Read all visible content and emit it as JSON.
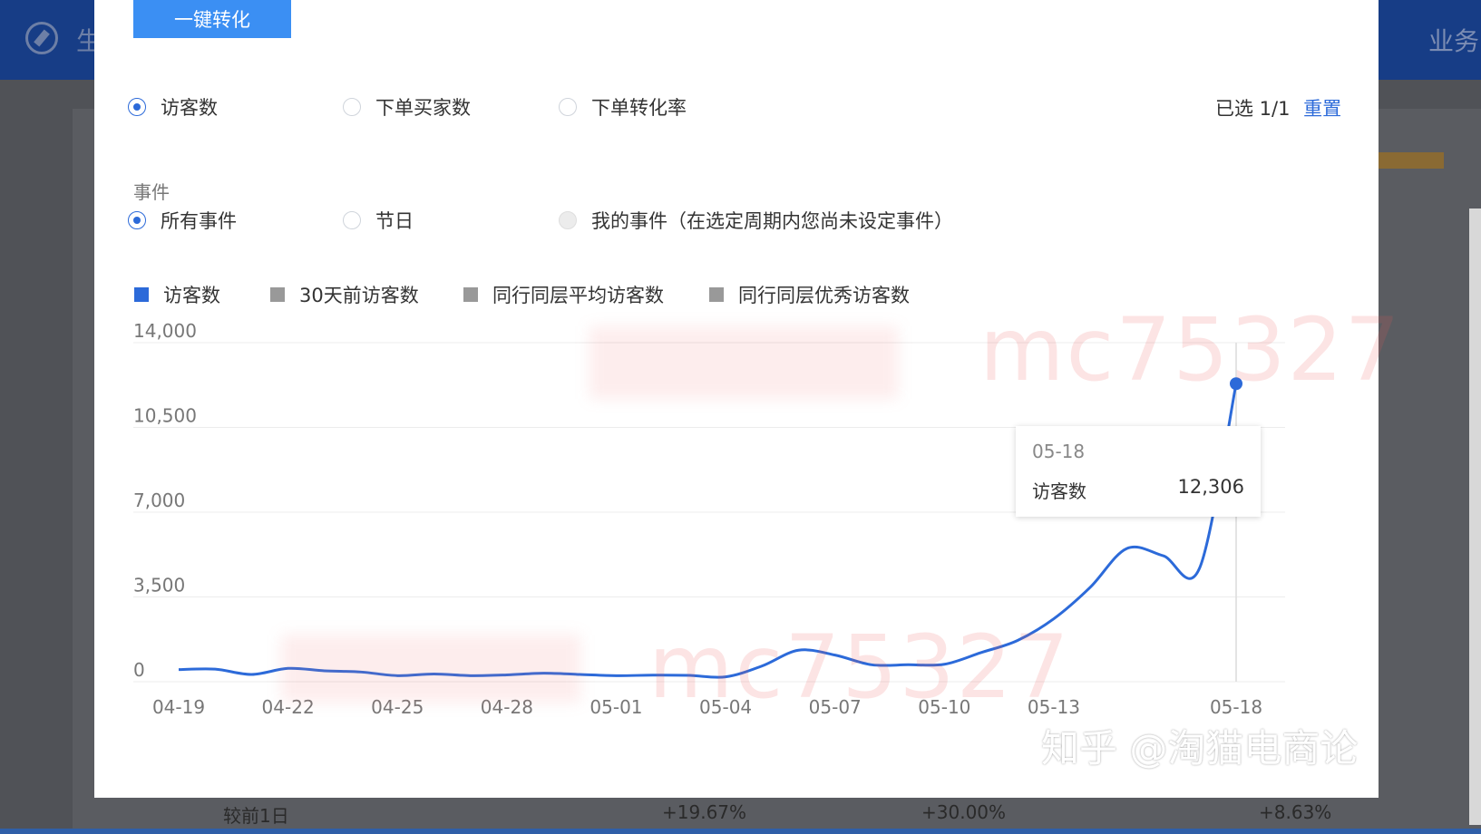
{
  "background": {
    "header_left_text": "生",
    "header_right_text": "业务",
    "footer_compare_label": "较前1日",
    "footer_values": [
      "+19.67%",
      "+30.00%",
      "+8.63%"
    ]
  },
  "modal": {
    "convert_button": "一键转化",
    "metric_options": [
      {
        "label": "访客数",
        "checked": true
      },
      {
        "label": "下单买家数",
        "checked": false
      },
      {
        "label": "下单转化率",
        "checked": false
      }
    ],
    "selected_text": "已选 1/1",
    "reset_label": "重置",
    "event_title": "事件",
    "event_options": [
      {
        "label": "所有事件",
        "checked": true
      },
      {
        "label": "节日",
        "checked": false
      },
      {
        "label": "我的事件（在选定周期内您尚未设定事件）",
        "checked": false,
        "disabled": true
      }
    ],
    "legend": [
      {
        "label": "访客数",
        "color": "#2c6ad9"
      },
      {
        "label": "30天前访客数",
        "color": "#999999"
      },
      {
        "label": "同行同层平均访客数",
        "color": "#999999"
      },
      {
        "label": "同行同层优秀访客数",
        "color": "#999999"
      }
    ],
    "tooltip": {
      "date": "05-18",
      "name": "访客数",
      "value": "12,306"
    }
  },
  "chart_data": {
    "type": "line",
    "y_ticks": [
      "14,000",
      "10,500",
      "7,000",
      "3,500",
      "0"
    ],
    "x_tick_labels": [
      "04-19",
      "04-22",
      "04-25",
      "04-28",
      "05-01",
      "05-04",
      "05-07",
      "05-10",
      "05-13",
      "05-18"
    ],
    "ylim": [
      0,
      14000
    ],
    "grid": true,
    "series": [
      {
        "name": "访客数",
        "color": "#2c6ad9",
        "x": [
          "04-19",
          "04-20",
          "04-21",
          "04-22",
          "04-23",
          "04-24",
          "04-25",
          "04-26",
          "04-27",
          "04-28",
          "04-29",
          "04-30",
          "05-01",
          "05-02",
          "05-03",
          "05-04",
          "05-05",
          "05-06",
          "05-07",
          "05-08",
          "05-09",
          "05-10",
          "05-11",
          "05-12",
          "05-13",
          "05-14",
          "05-15",
          "05-16",
          "05-17",
          "05-18"
        ],
        "values": [
          500,
          520,
          300,
          550,
          450,
          400,
          250,
          320,
          250,
          280,
          350,
          300,
          250,
          270,
          260,
          200,
          650,
          1300,
          1100,
          700,
          700,
          720,
          1200,
          1700,
          2600,
          3900,
          5500,
          5200,
          4700,
          12306
        ]
      }
    ]
  },
  "watermarks": {
    "repeat_text": "mc75327",
    "zhihu": "知乎 @淘猫电商论"
  }
}
